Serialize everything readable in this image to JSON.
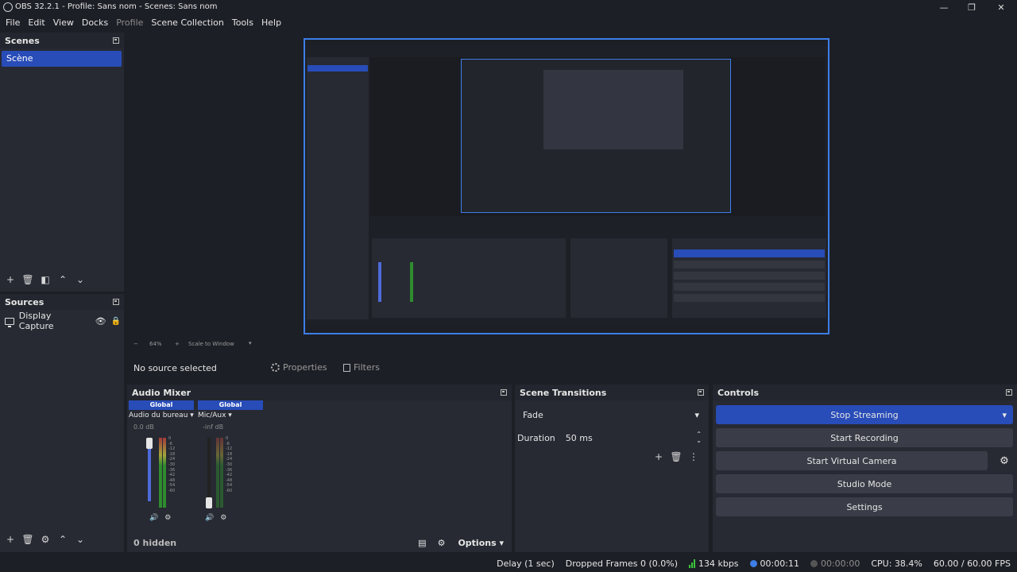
{
  "window": {
    "title": "OBS 32.2.1 - Profile: Sans nom - Scenes: Sans nom",
    "minimize": "—",
    "restore": "❐",
    "close": "✕"
  },
  "menu": {
    "items": [
      "File",
      "Edit",
      "View",
      "Docks",
      "Profile",
      "Scene Collection",
      "Tools",
      "Help"
    ]
  },
  "scenes": {
    "title": "Scenes",
    "items": [
      "Scène"
    ]
  },
  "sources": {
    "title": "Sources",
    "items": [
      "Display Capture"
    ]
  },
  "preview": {
    "zoom": "64%",
    "scale_mode": "Scale to Window",
    "minus": "−",
    "plus": "+"
  },
  "context": {
    "no_source": "No source selected",
    "properties": "Properties",
    "filters": "Filters"
  },
  "mixer": {
    "title": "Audio Mixer",
    "channels": [
      {
        "head": "Global",
        "name": "Audio du bureau",
        "db": "0.0 dB"
      },
      {
        "head": "Global",
        "name": "Mic/Aux",
        "db": "-inf dB"
      }
    ],
    "scale": [
      "0",
      "-6",
      "-12",
      "-18",
      "-24",
      "-30",
      "-36",
      "-42",
      "-48",
      "-54",
      "-60"
    ],
    "hidden": "0 hidden",
    "options": "Options"
  },
  "transitions": {
    "title": "Scene Transitions",
    "selected": "Fade",
    "duration_label": "Duration",
    "duration_value": "50 ms"
  },
  "controls": {
    "title": "Controls",
    "stop_streaming": "Stop Streaming",
    "start_recording": "Start Recording",
    "start_virtual_camera": "Start Virtual Camera",
    "studio_mode": "Studio Mode",
    "settings": "Settings"
  },
  "status": {
    "delay": "Delay (1 sec)",
    "dropped": "Dropped Frames 0 (0.0%)",
    "bitrate": "134 kbps",
    "stream_time": "00:00:11",
    "rec_time": "00:00:00",
    "cpu": "CPU: 38.4%",
    "fps": "60.00 / 60.00 FPS"
  },
  "colors": {
    "accent": "#284cb8",
    "background": "#1d1f26",
    "panel": "#272a33",
    "preview_border": "#3d7ee8"
  }
}
